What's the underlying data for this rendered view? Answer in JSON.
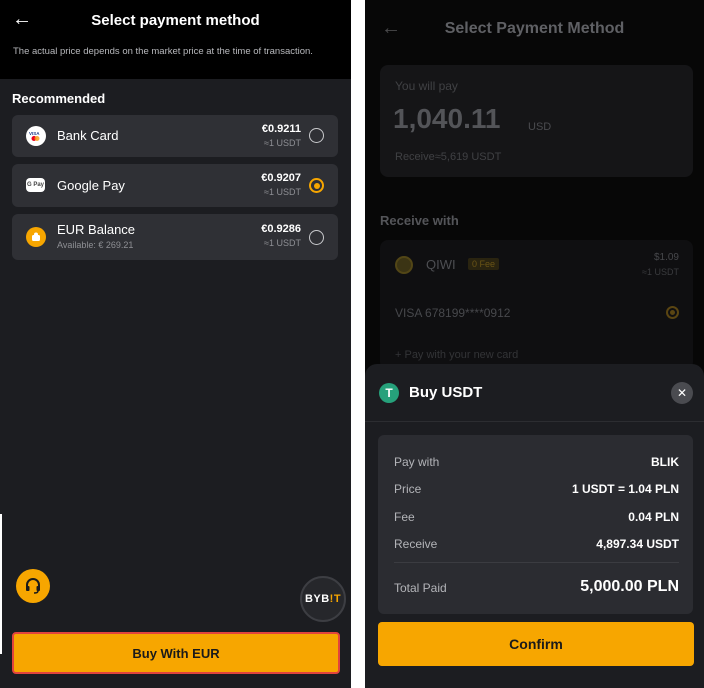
{
  "left_screen": {
    "title": "Select payment method",
    "note": "The actual price depends on the market price at the time of transaction.",
    "section_label": "Recommended",
    "methods": [
      {
        "name": "Bank Card",
        "sub": "",
        "price": "€0.9211",
        "usdt": "≈1 USDT",
        "icon": "visa-mastercard-icon",
        "selected": false
      },
      {
        "name": "Google Pay",
        "sub": "",
        "price": "€0.9207",
        "usdt": "≈1 USDT",
        "icon": "google-pay-icon",
        "selected": true
      },
      {
        "name": "EUR Balance",
        "sub": "Available: € 269.21",
        "price": "€0.9286",
        "usdt": "≈1 USDT",
        "icon": "eur-balance-icon",
        "selected": false
      }
    ],
    "bybit_logo": {
      "main": "BYB",
      "accent": "!T"
    },
    "buy_button_label": "Buy With EUR"
  },
  "right_screen": {
    "title": "Select Payment Method",
    "you_will_pay_label": "You will pay",
    "amount": "1,040.11",
    "currency": "USD",
    "receive_estimate": "Receive≈5,619 USDT",
    "receive_with_label": "Receive with",
    "qiwi": {
      "name": "QIWI",
      "fee_badge": "0 Fee",
      "price": "$1.09",
      "usdt": "≈1 USDT"
    },
    "visa_card": "VISA 678199****0912",
    "new_card": "+ Pay with your new card",
    "sheet": {
      "title": "Buy USDT",
      "rows": [
        {
          "label": "Pay with",
          "value": "BLIK"
        },
        {
          "label": "Price",
          "value": "1 USDT = 1.04 PLN"
        },
        {
          "label": "Fee",
          "value": "0.04 PLN"
        },
        {
          "label": "Receive",
          "value": "4,897.34 USDT"
        }
      ],
      "total_label": "Total Paid",
      "total_value": "5,000.00 PLN",
      "confirm_label": "Confirm"
    }
  },
  "colors": {
    "accent": "#f7a600",
    "usdt_green": "#26a17b",
    "highlight_border": "#e2443d"
  }
}
